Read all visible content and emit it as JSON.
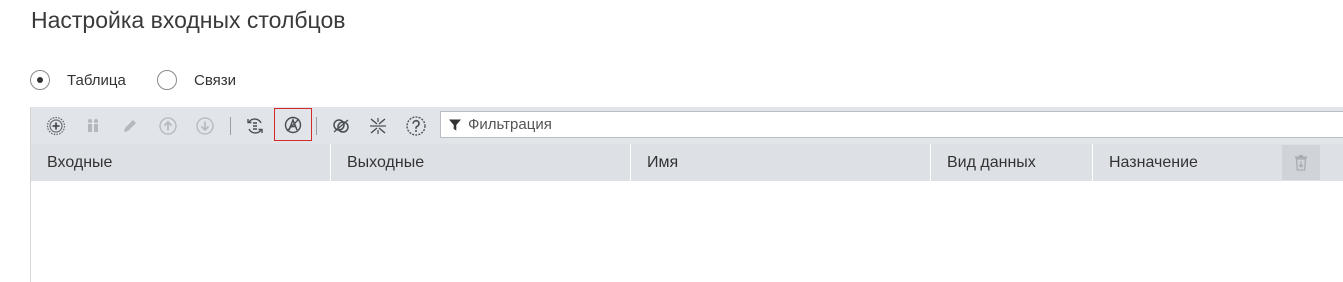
{
  "page": {
    "title": "Настройка входных столбцов"
  },
  "mode_radio": {
    "options": [
      {
        "label": "Таблица",
        "selected": true
      },
      {
        "label": "Связи",
        "selected": false
      }
    ]
  },
  "toolbar": {
    "buttons": [
      {
        "icon": "add-circle-icon",
        "enabled": true
      },
      {
        "icon": "duplicate-icon",
        "enabled": false
      },
      {
        "icon": "edit-pencil-icon",
        "enabled": false
      },
      {
        "icon": "move-up-icon",
        "enabled": false
      },
      {
        "icon": "move-down-icon",
        "enabled": false
      },
      {
        "icon": "refresh-columns-icon",
        "enabled": true
      },
      {
        "icon": "auto-map-icon",
        "enabled": true,
        "highlighted": true
      },
      {
        "icon": "unlink-icon",
        "enabled": true
      },
      {
        "icon": "merge-icon",
        "enabled": true
      },
      {
        "icon": "help-icon",
        "enabled": true
      }
    ],
    "filter": {
      "placeholder": "Фильтрация",
      "value": ""
    }
  },
  "table": {
    "columns": [
      "Входные",
      "Выходные",
      "Имя",
      "Вид данных",
      "Назначение"
    ],
    "rows": []
  },
  "colors": {
    "toolbar_bg": "#e1e4e8",
    "header_bg": "#dde1e6",
    "highlight_border": "#d02a2a"
  }
}
